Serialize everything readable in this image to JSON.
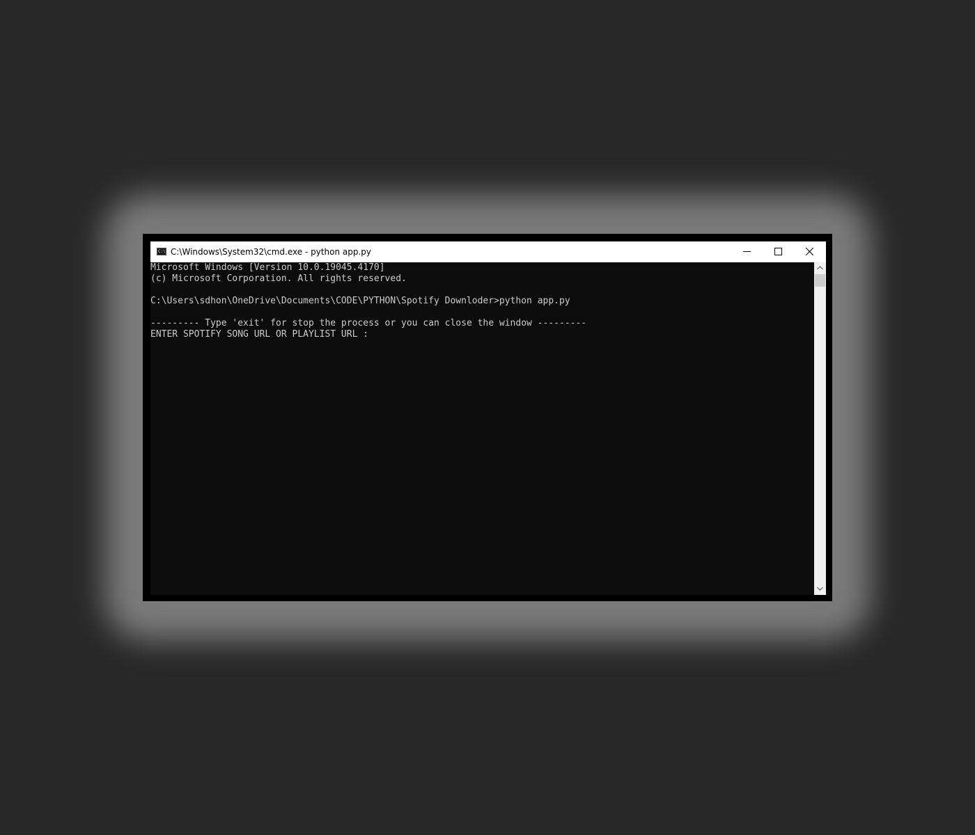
{
  "window": {
    "title": "C:\\Windows\\System32\\cmd.exe - python  app.py",
    "icon": "cmd-icon",
    "icon_text": "C:\\",
    "controls": {
      "minimize": "minimize-icon",
      "maximize": "maximize-icon",
      "close": "close-icon"
    }
  },
  "console": {
    "lines": [
      "Microsoft Windows [Version 10.0.19045.4170]",
      "(c) Microsoft Corporation. All rights reserved.",
      "",
      "C:\\Users\\sdhon\\OneDrive\\Documents\\CODE\\PYTHON\\Spotify Downloder>python app.py",
      "",
      "--------- Type 'exit' for stop the process or you can close the window ---------",
      "ENTER SPOTIFY SONG URL OR PLAYLIST URL :"
    ]
  },
  "scrollbar": {
    "up": "chevron-up-icon",
    "down": "chevron-down-icon"
  },
  "colors": {
    "desktop": "#282828",
    "console_bg": "#0c0c0c",
    "console_text": "#cccccc",
    "titlebar_bg": "#ffffff"
  }
}
